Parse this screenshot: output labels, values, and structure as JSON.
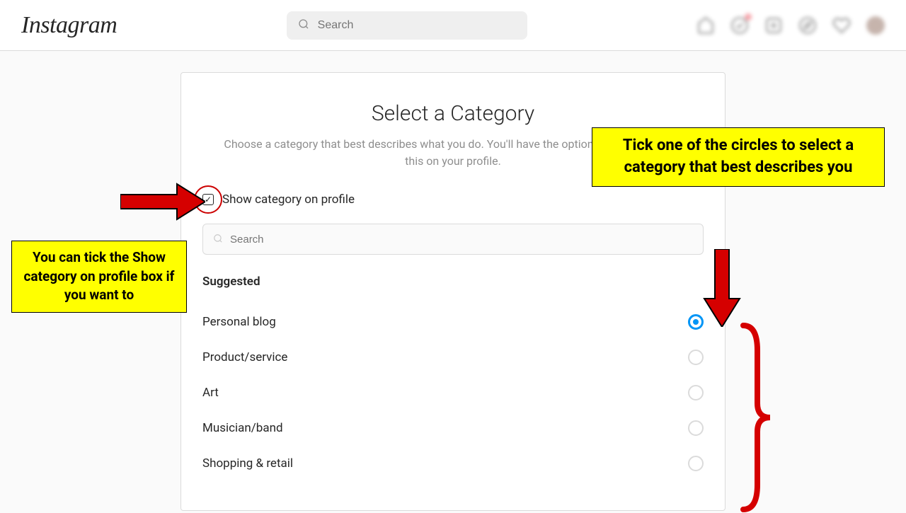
{
  "header": {
    "logo": "Instagram",
    "search_placeholder": "Search"
  },
  "panel": {
    "title": "Select a Category",
    "subtitle": "Choose a category that best describes what you do. You'll have the option to display or hide this on your profile.",
    "show_on_profile_label": "Show category on profile",
    "show_on_profile_checked": true,
    "category_search_placeholder": "Search",
    "suggested_label": "Suggested",
    "options": [
      {
        "label": "Personal blog",
        "selected": true
      },
      {
        "label": "Product/service",
        "selected": false
      },
      {
        "label": "Art",
        "selected": false
      },
      {
        "label": "Musician/band",
        "selected": false
      },
      {
        "label": "Shopping & retail",
        "selected": false
      }
    ]
  },
  "annotations": {
    "left_callout": "You can tick the Show category on profile box if you want to",
    "right_callout": "Tick one of the circles to select a category that best describes you"
  },
  "colors": {
    "accent": "#0095f6",
    "annotation_arrow": "#d50000",
    "annotation_bg": "#ffff00"
  }
}
